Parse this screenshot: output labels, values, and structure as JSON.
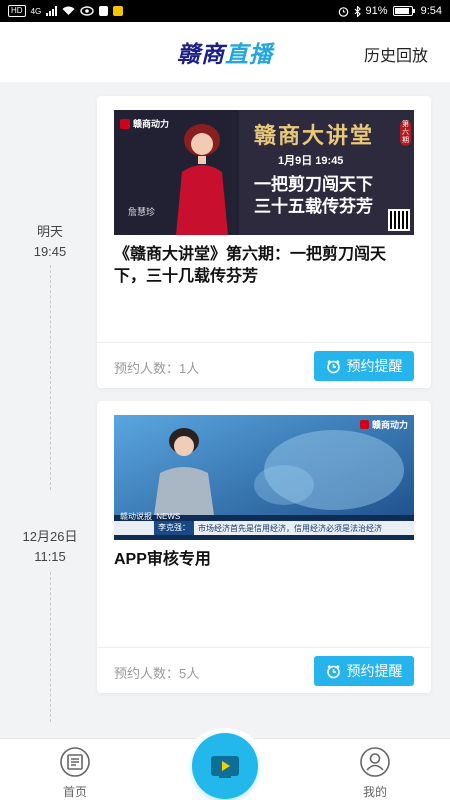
{
  "status_bar": {
    "network_left": "HD",
    "signal_label": "4G",
    "battery": "91%",
    "battery_level": 0.91,
    "time": "9:54"
  },
  "header": {
    "title_part1": "赣商",
    "title_part2": "直播",
    "history": "历史回放"
  },
  "timeline": [
    {
      "day": "明天",
      "time": "19:45"
    },
    {
      "day": "12月26日",
      "time": "11:15"
    }
  ],
  "cards": [
    {
      "title": "《赣商大讲堂》第六期：一把剪刀闯天下，三十几载传芬芳",
      "subscribe_label": "预约人数：1人",
      "remind_label": "预约提醒",
      "thumbnail": {
        "brand": "赣商动力",
        "series": "赣商大讲堂",
        "issue": "第六期",
        "date": "1月9日 19:45",
        "line1": "一把剪刀闯天下",
        "line2": "三十五载传芬芳",
        "speaker": "詹慧珍"
      }
    },
    {
      "title": "APP审核专用",
      "subscribe_label": "预约人数：5人",
      "remind_label": "预约提醒",
      "thumbnail": {
        "brand": "赣商动力",
        "tag": "赣动说报",
        "tag_en": "NEWS",
        "speaker": "李克强：",
        "ticker": "市场经济首先是信用经济，信用经济必须是法治经济"
      }
    }
  ],
  "bottom_nav": {
    "home": "首页",
    "mine": "我的",
    "home_icon": "home-icon",
    "mine_icon": "user-icon",
    "live_icon": "play-icon"
  },
  "colors": {
    "accent": "#23b8ec",
    "brand_dark": "#1d2088",
    "card_red": "#c8102e"
  }
}
